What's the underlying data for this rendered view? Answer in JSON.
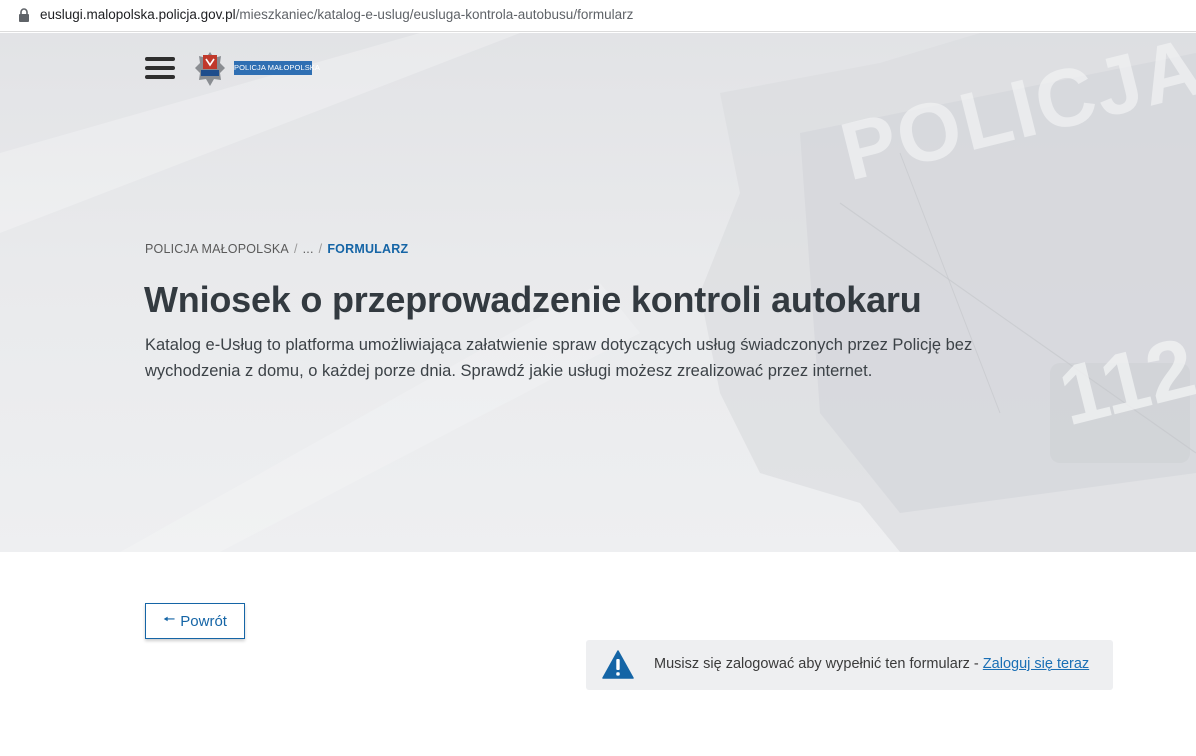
{
  "browser": {
    "url_domain": "euslugi.malopolska.policja.gov.pl",
    "url_path": "/mieszkaniec/katalog-e-uslug/eusluga-kontrola-autobusu/formularz"
  },
  "header": {
    "logo_text": "POLICJA MAŁOPOLSKA",
    "badge_text": "POLICJA",
    "watermark_text": "POLICJA",
    "watermark_number": "112"
  },
  "breadcrumb": {
    "items": [
      "POLICJA MAŁOPOLSKA",
      "...",
      "FORMULARZ"
    ],
    "separator": "/"
  },
  "page": {
    "title": "Wniosek o przeprowadzenie kontroli autokaru",
    "lead": "Katalog e-Usług to platforma umożliwiająca załatwienie spraw dotyczących usług świadczonych przez Policję bez wychodzenia z domu, o każdej porze dnia. Sprawdź jakie usługi możesz zrealizować przez internet."
  },
  "actions": {
    "back_label": "Powrót",
    "back_arrow": "🠔"
  },
  "alert": {
    "message": "Musisz się zalogować aby wypełnić ten formularz - ",
    "link_label": "Zaloguj się teraz"
  },
  "colors": {
    "accent": "#1565a6",
    "warning_icon": "#1565a6",
    "hero_bg": "#e6e7ea",
    "alert_bg": "#eeeff1"
  }
}
